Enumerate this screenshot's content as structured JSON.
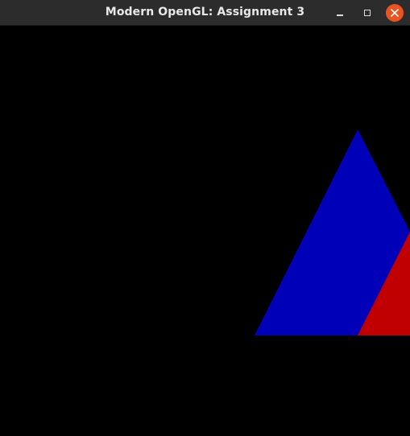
{
  "window": {
    "title": "Modern OpenGL: Assignment 3",
    "controls": [
      "minimize",
      "maximize",
      "close"
    ],
    "close_button_color": "#e95420"
  },
  "scene": {
    "background_color": "#000000",
    "shapes": [
      {
        "name": "blue-triangle",
        "color": "#0000b8"
      },
      {
        "name": "red-triangle",
        "color": "#c00000"
      }
    ]
  }
}
